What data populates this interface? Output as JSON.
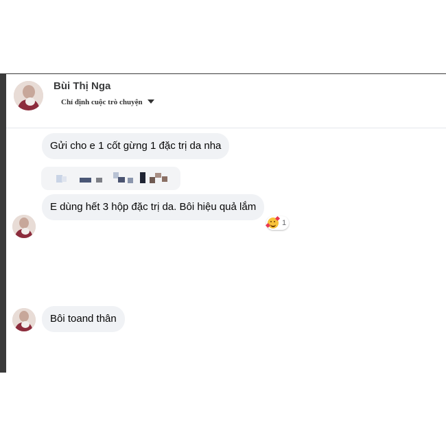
{
  "contact": {
    "name": "Bùi Thị Nga",
    "subtitle": "Chỉ định cuộc trò chuyện"
  },
  "messages": [
    {
      "text": "Gửi cho e 1 cốt gừng 1 đặc trị da nha"
    },
    {
      "text": "[blurred content]"
    },
    {
      "text": "E dùng hết 3 hộp đặc trị da. Bôi hiệu quả lắm"
    },
    {
      "text": "Bôi toand thân"
    }
  ],
  "reaction": {
    "emoji": "smiling-face-with-hearts-icon",
    "count": "1"
  },
  "colors": {
    "bubble": "#f0f2f5",
    "frame": "#3a3a3a",
    "text": "#050505"
  }
}
